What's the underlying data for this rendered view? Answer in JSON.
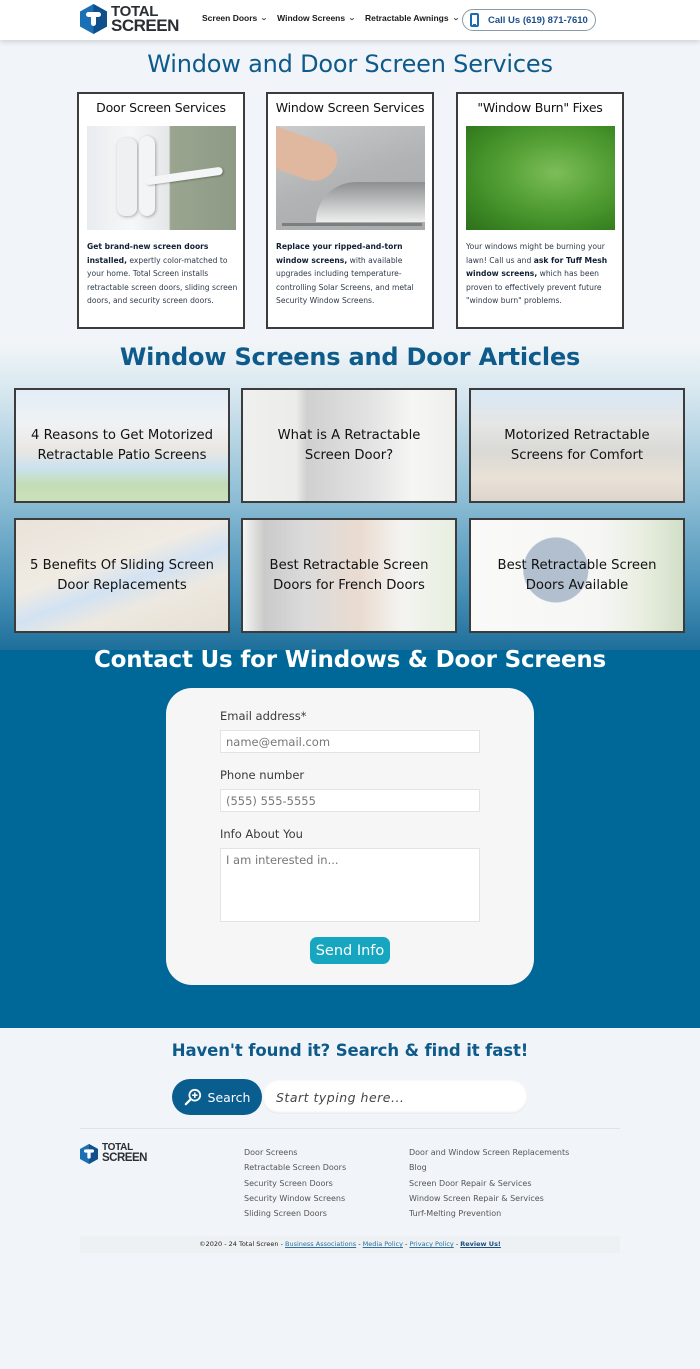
{
  "header": {
    "logo": {
      "line1": "TOTAL",
      "line2": "SCREEN"
    },
    "nav": [
      {
        "label": "Screen Doors"
      },
      {
        "label": "Window Screens"
      },
      {
        "label": "Retractable Awnings"
      }
    ],
    "call_button": {
      "label": "Call Us (619) 871-7610",
      "icon": "phone-icon"
    }
  },
  "colors": {
    "brand_blue": "#0e5a8a",
    "contact_bg": "#006899",
    "send_button": "#16a6bf",
    "search_button": "#0a5d8f"
  },
  "services": {
    "title": "Window and Door Screen Services",
    "cards": [
      {
        "title": "Door Screen Services",
        "image": "screen-door-latch-image",
        "bold": "Get brand-new screen doors installed,",
        "text": " expertly color-matched to your home. Total Screen installs retractable screen doors, sliding screen doors, and security screen doors."
      },
      {
        "title": "Window Screen Services",
        "image": "torn-window-screen-image",
        "bold": "Replace your ripped-and-torn window screens,",
        "text": " with available upgrades including temperature-controlling Solar Screens, and metal Security Window Screens."
      },
      {
        "title": "\"Window Burn\" Fixes",
        "image": "grass-lawn-image",
        "text_before": "Your windows might be burning your lawn! Call us and ",
        "bold": "ask for Tuff Mesh window screens,",
        "text": " which has been proven to effectively prevent future \"window burn\" problems."
      }
    ]
  },
  "articles": {
    "title": "Window Screens and Door Articles",
    "items": [
      {
        "label": "4 Reasons to Get Motorized Retractable Patio Screens"
      },
      {
        "label": "What is A Retractable Screen Door?"
      },
      {
        "label": "Motorized Retractable Screens for Comfort"
      },
      {
        "label": "5 Benefits Of Sliding Screen Door Replacements"
      },
      {
        "label": "Best Retractable Screen Doors for French Doors"
      },
      {
        "label": "Best Retractable Screen Doors Available"
      }
    ]
  },
  "contact": {
    "title": "Contact Us for Windows & Door Screens",
    "email": {
      "label": "Email address*",
      "placeholder": "name@email.com",
      "value": ""
    },
    "phone": {
      "label": "Phone number",
      "placeholder": "(555) 555-5555",
      "value": ""
    },
    "info": {
      "label": "Info About You",
      "placeholder": "I am interested in...",
      "value": ""
    },
    "submit_label": "Send Info"
  },
  "search": {
    "title": "Haven't found it? Search & find it fast!",
    "button_label": "Search",
    "placeholder": "Start typing here...",
    "value": ""
  },
  "footer": {
    "logo": {
      "line1": "TOTAL",
      "line2": "SCREEN"
    },
    "col1": [
      "Door Screens",
      "Retractable Screen Doors",
      "Security Screen Doors",
      "Security Window Screens",
      "Sliding Screen Doors"
    ],
    "col2": [
      "Door and Window Screen Replacements",
      "Blog",
      "Screen Door Repair & Services",
      "Window Screen Repair & Services",
      "Turf-Melting Prevention"
    ],
    "copyright": {
      "text": "©2020 - 24 Total Screen",
      "sep": " - ",
      "links": [
        "Business Associations",
        "Media Policy",
        "Privacy Policy",
        "Review Us!"
      ]
    }
  }
}
